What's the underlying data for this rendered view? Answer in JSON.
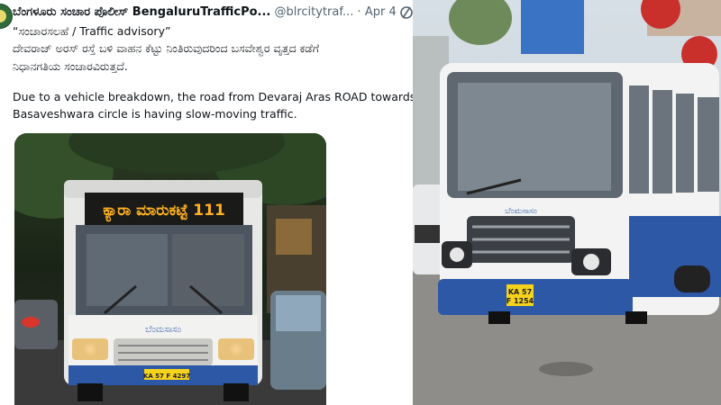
{
  "tweet": {
    "display_name": "ಬೆಂಗಳೂರು ಸಂಚಾರ ಪೊಲೀಸ್ BengaluruTrafficPo...",
    "handle": "@blrcitytraf...",
    "separator": "·",
    "date": "Apr 4",
    "title_line": "“ಸಂಚಾರಸಲಹೆ / Traffic advisory”",
    "kannada_line1": "ದೇವರಾಜ್ ಅರಸ್ ರಸ್ತೆ ಬಳಿ ವಾಹನ ಕೆಟ್ಟು ನಿಂತಿರುವುದರಿಂದ ಬಸವೇಶ್ವರ ವೃತ್ತದ ಕಡೆಗೆ",
    "kannada_line2": "ನಿಧಾನಗತಿಯ ಸಂಚಾರವಿರುತ್ತದೆ.",
    "english_line1": "Due to a vehicle breakdown, the road from  Devaraj Aras ROAD towards",
    "english_line2": "Basaveshwara circle is having slow-moving traffic."
  },
  "left_photo": {
    "destination_board": "ಕ್ಯಾರಾ ಮಾರುಕಟ್ಟೆ 111",
    "bus_logo_text": "ಬೆಂಮಸಾಸಂ",
    "plate": "KA 57 F 4297"
  },
  "right_photo": {
    "bus_logo_text": "ಬೆಂಮಸಾಸಂ",
    "plate_line1": "KA 57",
    "plate_line2": "F 1254"
  },
  "colors": {
    "name_text": "#0f1419",
    "muted_text": "#536471",
    "destination_led": "#ffb020",
    "bus_blue": "#2c58a6",
    "bus_white": "#f2f3f2",
    "plate_yellow": "#f5d21c"
  },
  "icons": [
    "avatar",
    "grok-icon"
  ]
}
